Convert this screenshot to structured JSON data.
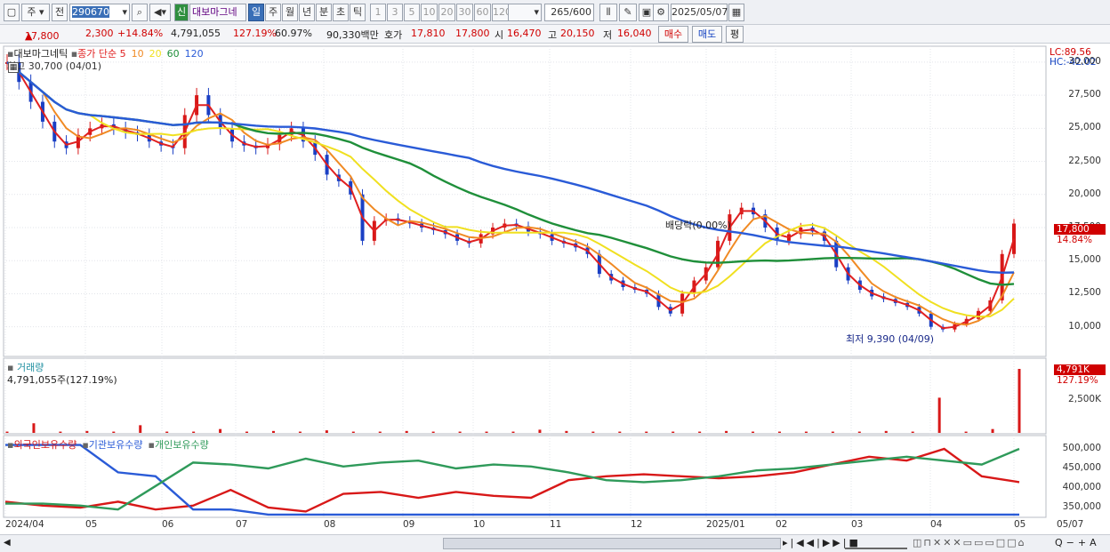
{
  "toolbar": {
    "type_select": "주",
    "prev_label": "전",
    "code": "290670",
    "new_badge": "신",
    "stock_name": "대보마그네",
    "periods": [
      "일",
      "주",
      "월",
      "년",
      "분",
      "초",
      "틱"
    ],
    "active_period": "일",
    "intervals": [
      "1",
      "3",
      "5",
      "10",
      "20",
      "30",
      "60",
      "120"
    ],
    "count": "265",
    "count_max": "/600",
    "date": "2025/05/07"
  },
  "info": {
    "price": "17,800",
    "change": "2,300",
    "change_pct": "+14.84%",
    "volume": "4,791,055",
    "volume_ratio": "127.19%",
    "turnover": "60.97%",
    "amount": "90,330백만",
    "hoga_label": "호가",
    "ask": "17,810",
    "bid": "17,800",
    "open_label": "시",
    "open": "16,470",
    "high_label": "고",
    "high": "20,150",
    "low_label": "저",
    "low": "16,040",
    "buy_label": "매수",
    "sell_label": "매도",
    "avg_label": "평"
  },
  "price_panel": {
    "legend_name": "대보마그네틱",
    "legend_ma": "종가 단순",
    "ma_periods": [
      "5",
      "10",
      "20",
      "60",
      "120"
    ],
    "ma_colors": [
      "#e02020",
      "#f08a24",
      "#f0e020",
      "#1f8f3a",
      "#2a5bd7"
    ],
    "high_note": "최고 30,700 (04/01)",
    "low_note": "최저 9,390 (04/09)",
    "dividend_note": "배당락(0.00%)",
    "lc": "LC:89.56",
    "hc": "HC:-42.02",
    "price_tag": "17,800",
    "pct_tag": "14.84%",
    "y_ticks": [
      "30,000",
      "27,500",
      "25,000",
      "22,500",
      "20,000",
      "17,500",
      "15,000",
      "12,500",
      "10,000"
    ]
  },
  "volume_panel": {
    "title": "거래량",
    "value": "4,791,055주(127.19%)",
    "tag": "4,791K",
    "tag_pct": "127.19%",
    "y_tick": "2,500K"
  },
  "holding_panel": {
    "legend": [
      "외국인보유수량",
      "기관보유수량",
      "개인보유수량"
    ],
    "colors": [
      "#d81818",
      "#2a5bd7",
      "#2f9a5a"
    ],
    "y_ticks": [
      "500,000",
      "450,000",
      "400,000",
      "350,000"
    ]
  },
  "x_axis": [
    "2024/04",
    "05",
    "06",
    "07",
    "08",
    "09",
    "10",
    "11",
    "12",
    "2025/01",
    "02",
    "03",
    "04",
    "05",
    "05/07"
  ],
  "chart_data": {
    "type": "line",
    "title": "대보마그네틱",
    "price_ylim": [
      8500,
      31000
    ],
    "close": [
      30000,
      28500,
      27000,
      25500,
      24000,
      23500,
      24500,
      25000,
      25300,
      25000,
      24700,
      24500,
      24000,
      23700,
      23500,
      26000,
      27500,
      26000,
      25000,
      24000,
      23700,
      23500,
      23800,
      24500,
      25000,
      24000,
      23000,
      21500,
      21000,
      20000,
      16500,
      18000,
      18200,
      18000,
      17800,
      17500,
      17300,
      17000,
      16500,
      16300,
      17000,
      17500,
      17800,
      17600,
      17200,
      17000,
      16500,
      16300,
      16000,
      15500,
      14000,
      13500,
      13000,
      12800,
      12500,
      11500,
      11000,
      12500,
      13500,
      14500,
      16500,
      18500,
      19000,
      18500,
      17500,
      16500,
      17000,
      17500,
      17200,
      16500,
      14500,
      13500,
      12800,
      12300,
      12100,
      11800,
      11500,
      11000,
      10000,
      9800,
      10200,
      10600,
      11200,
      12000,
      15500,
      17800
    ],
    "volume_bars": [
      0.02,
      0.15,
      0.02,
      0.03,
      0.02,
      0.12,
      0.02,
      0.02,
      0.06,
      0.02,
      0.03,
      0.02,
      0.04,
      0.02,
      0.02,
      0.03,
      0.02,
      0.02,
      0.02,
      0.02,
      0.05,
      0.03,
      0.02,
      0.02,
      0.02,
      0.02,
      0.02,
      0.03,
      0.02,
      0.02,
      0.02,
      0.02,
      0.02,
      0.03,
      0.02,
      0.55,
      0.02,
      0.06,
      1.0
    ],
    "foreign_holding": [
      365000,
      355000,
      350000,
      365000,
      345000,
      355000,
      395000,
      350000,
      340000,
      385000,
      390000,
      375000,
      390000,
      380000,
      375000,
      420000,
      430000,
      435000,
      430000,
      425000,
      430000,
      440000,
      460000,
      480000,
      470000,
      500000,
      430000,
      415000
    ],
    "institution_holding": [
      510000,
      510000,
      510000,
      440000,
      430000,
      345000,
      345000,
      332000,
      332000,
      332000,
      332000,
      332000,
      332000,
      332000,
      332000,
      332000,
      332000,
      332000,
      332000,
      332000,
      332000,
      332000,
      332000,
      332000,
      332000,
      332000,
      332000,
      332000
    ],
    "individual_holding": [
      360000,
      360000,
      355000,
      345000,
      405000,
      465000,
      460000,
      450000,
      475000,
      455000,
      465000,
      470000,
      450000,
      460000,
      455000,
      440000,
      420000,
      415000,
      420000,
      430000,
      445000,
      450000,
      460000,
      470000,
      480000,
      470000,
      460000,
      500000
    ],
    "holding_ylim": [
      325000,
      525000
    ]
  }
}
